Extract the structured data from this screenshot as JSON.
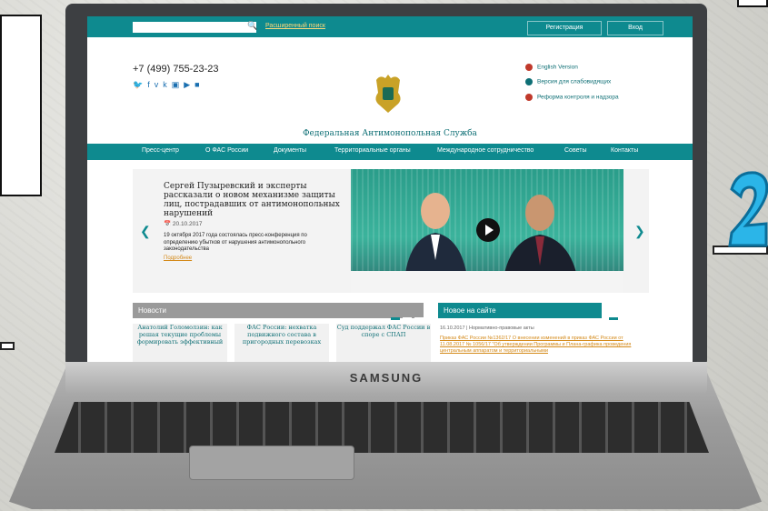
{
  "topbar": {
    "search_placeholder": "",
    "extended_search": "Расширенный поиск",
    "register": "Регистрация",
    "login": "Вход"
  },
  "header": {
    "phone": "+7 (499) 755-23-23",
    "social_icons": [
      "twitter-icon",
      "facebook-icon",
      "vk-icon",
      "instagram-icon",
      "youtube-icon",
      "camera-icon"
    ],
    "agency_name": "Федеральная Антимонопольная Служба",
    "right_links": [
      {
        "label": "English Version",
        "icon": "globe-icon"
      },
      {
        "label": "Версия для слабовидящих",
        "icon": "eye-icon"
      },
      {
        "label": "Реформа контроля и надзора",
        "icon": "reform-icon"
      }
    ]
  },
  "nav": [
    "Пресс-центр",
    "О ФАС России",
    "Документы",
    "Территориальные органы",
    "Международное сотрудничество",
    "Советы",
    "Контакты"
  ],
  "slide": {
    "title": "Сергей Пузыревский и эксперты рассказали о новом механизме защиты лиц, пострадавших от антимонопольных нарушений",
    "date": "20.10.2017",
    "text": "19 октября 2017 года состоялась пресс-конференция по определению убытков от нарушения антимонопольного законодательства",
    "more": "Подробнее"
  },
  "news": {
    "title": "Новости",
    "cards": [
      "Анатолий Голомолзин: как решая текущие проблемы формировать эффективный",
      "ФАС России: нехватка подвижного состава в пригородных перевозках",
      "Суд поддержал ФАС России в споре с СПАП"
    ]
  },
  "site": {
    "title": "Новое на сайте",
    "date": "16.10.2017 | Нормативно-правовые акты",
    "link": "Приказ ФАС России №1362/17 О внесении изменений в приказ ФАС России от 11.08.2017 № 1056/17 \"Об утверждении Программы и Плана-графика проведения центральным аппаратом и территориальными"
  },
  "laptop": {
    "brand": "SAMSUNG"
  },
  "colors": {
    "teal": "#0e8a8f",
    "gray_header": "#9a9a9a",
    "link_orange": "#d48a1a"
  }
}
